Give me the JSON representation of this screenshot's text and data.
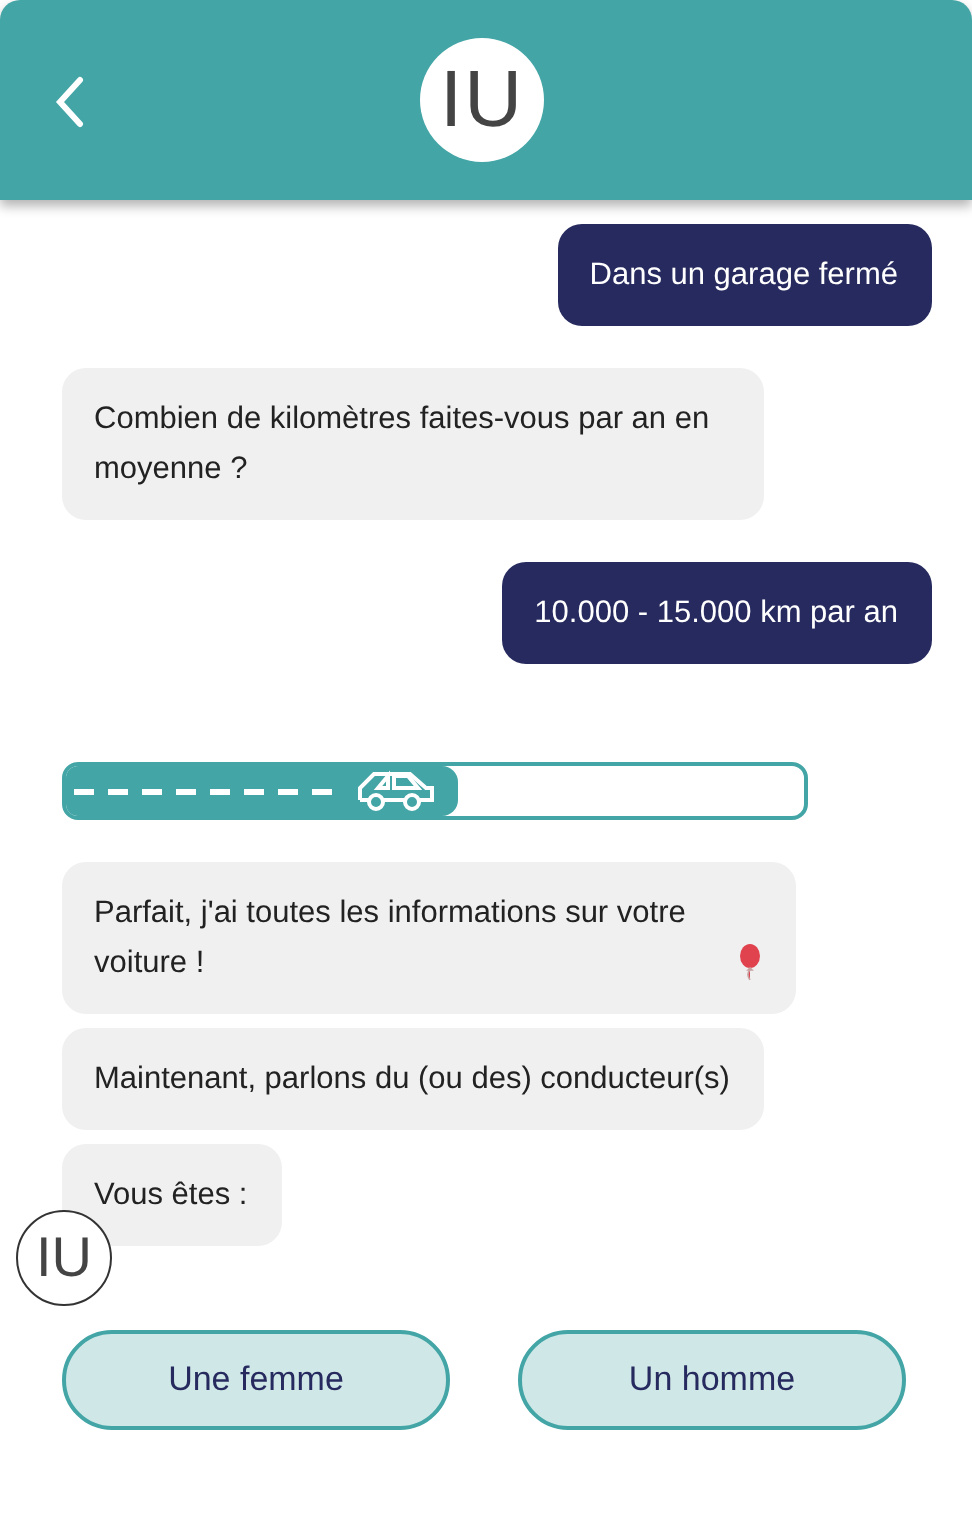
{
  "header": {
    "logo": "IU"
  },
  "messages": [
    {
      "kind": "user",
      "text": "Dans un garage fermé",
      "has_icon": false
    },
    {
      "kind": "bot",
      "text": "Combien de kilomètres faites-vous par an en moyenne ?",
      "has_icon": false
    },
    {
      "kind": "user",
      "text": "10.000 - 15.000 km par an",
      "has_icon": false
    },
    {
      "kind": "progress",
      "level": 0.53
    },
    {
      "kind": "bot",
      "text": "Parfait, j'ai toutes les informations sur votre voiture !",
      "has_icon": true
    },
    {
      "kind": "bot",
      "text": "Maintenant, parlons du (ou des) conducteur(s)",
      "has_icon": false
    },
    {
      "kind": "bot",
      "text": "Vous êtes :",
      "has_icon": false
    }
  ],
  "avatar": {
    "logo": "IU"
  },
  "choices": [
    {
      "label": "Une femme"
    },
    {
      "label": "Un homme"
    }
  ]
}
